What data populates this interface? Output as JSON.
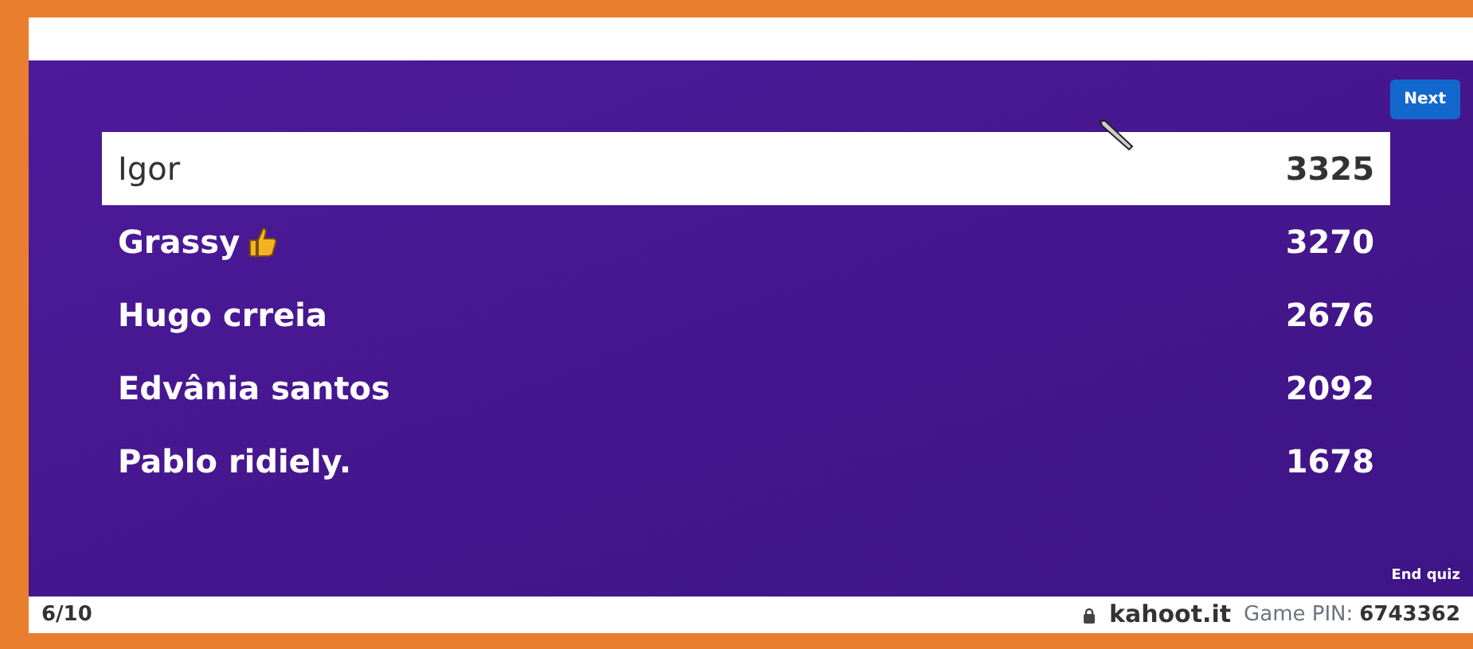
{
  "next_button": "Next",
  "scoreboard": [
    {
      "name": "Igor",
      "score": "3325",
      "selected": true,
      "thumbs_up": false
    },
    {
      "name": "Grassy",
      "score": "3270",
      "selected": false,
      "thumbs_up": true
    },
    {
      "name": "Hugo crreia",
      "score": "2676",
      "selected": false,
      "thumbs_up": false
    },
    {
      "name": "Edvânia santos",
      "score": "2092",
      "selected": false,
      "thumbs_up": false
    },
    {
      "name": "Pablo ridiely.",
      "score": "1678",
      "selected": false,
      "thumbs_up": false
    }
  ],
  "end_quiz": "End quiz",
  "footer": {
    "progress": "6/10",
    "site": "kahoot.it",
    "pin_label": "Game PIN:",
    "pin": "6743362"
  }
}
